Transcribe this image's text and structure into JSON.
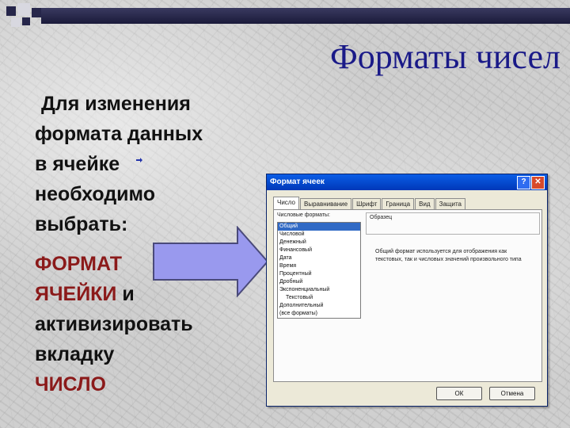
{
  "slide": {
    "title": "Форматы чисел",
    "text_lines_1": [
      "Для изменения",
      "формата данных",
      "в ячейке",
      "необходимо",
      "выбрать:"
    ],
    "format_red": "ФОРМАТ",
    "cells_red": "ЯЧЕЙКИ",
    "and_word": " и",
    "activate": "активизировать",
    "tab_word": "вкладку",
    "number_red": "ЧИСЛО",
    "accent_color": "#8b1a1a",
    "title_color": "#1a1a88"
  },
  "dialog": {
    "title": "Формат ячеек",
    "help": "?",
    "close": "✕",
    "tabs": [
      "Число",
      "Выравнивание",
      "Шрифт",
      "Граница",
      "Вид",
      "Защита"
    ],
    "formats_label": "Числовые форматы:",
    "formats": [
      "Общий",
      "Числовой",
      "Денежный",
      "Финансовый",
      "Дата",
      "Время",
      "Процентный",
      "Дробный",
      "Экспоненциальный",
      "Текстовый",
      "Дополнительный",
      "(все форматы)"
    ],
    "selected_index": 0,
    "sample_label": "Образец",
    "description": "Общий формат используется для отображения как текстовых, так и числовых значений произвольного типа",
    "ok": "ОК",
    "cancel": "Отмена"
  }
}
